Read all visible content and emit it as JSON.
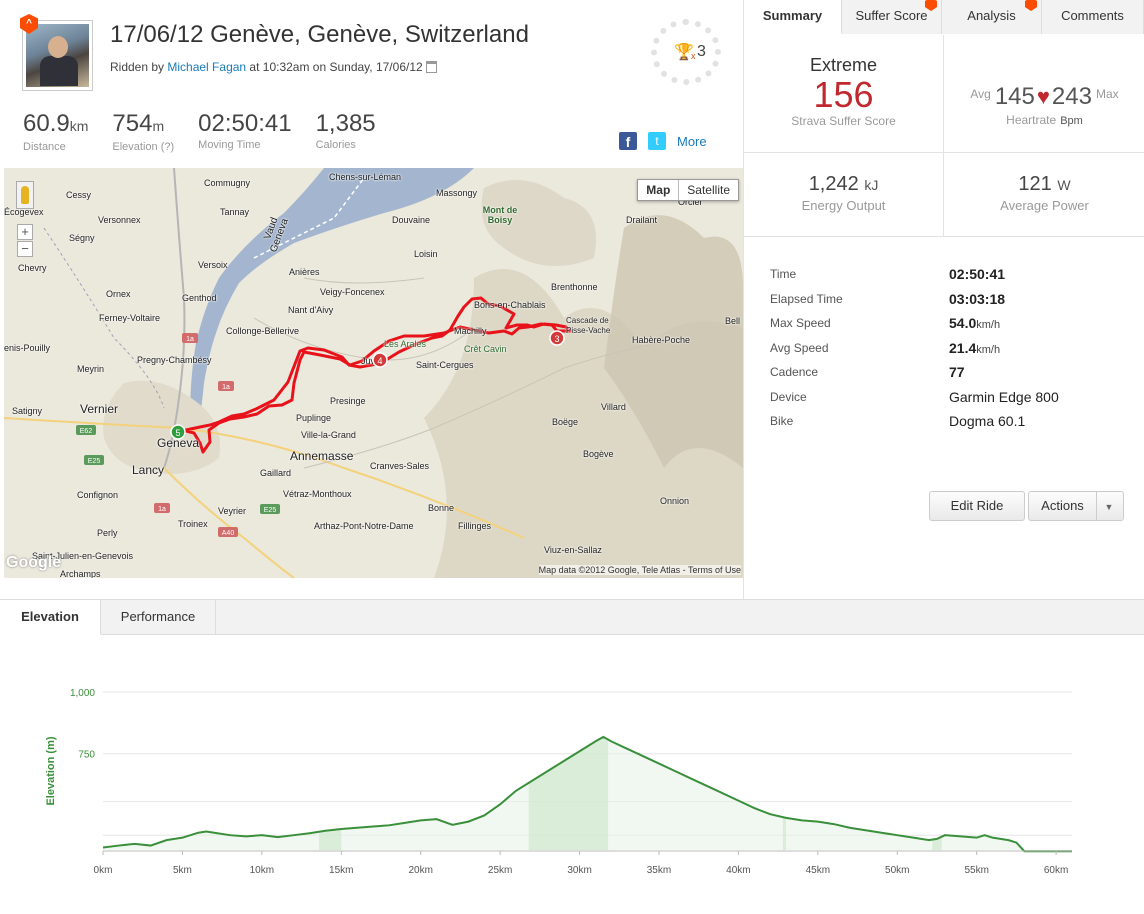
{
  "header": {
    "title": "17/06/12 Genève, Genève, Switzerland",
    "ridden_by_prefix": "Ridden by ",
    "athlete_name": "Michael Fagan",
    "ridden_suffix": " at 10:32am on Sunday, 17/06/12",
    "trophy_count": "3",
    "trophy_multiplier": "x"
  },
  "stats": [
    {
      "value": "60.9",
      "unit": "km",
      "label": "Distance"
    },
    {
      "value": "754",
      "unit": "m",
      "label": "Elevation (?)"
    },
    {
      "value": "02:50:41",
      "unit": "",
      "label": "Moving Time"
    },
    {
      "value": "1,385",
      "unit": "",
      "label": "Calories"
    }
  ],
  "share": {
    "facebook": "f",
    "twitter": "t",
    "more": "More"
  },
  "map": {
    "type_map": "Map",
    "type_satellite": "Satellite",
    "credit": "Map data ©2012 Google, Tele Atlas - Terms of Use",
    "google": "Google",
    "labels": [
      "Chens-sur-Léman",
      "Massongy",
      "Commugny",
      "Cessy",
      "Tannay",
      "Écogevex",
      "Versonnex",
      "Mont de Boisy",
      "Douvaine",
      "Drailant",
      "Orcier",
      "Ségny",
      "Vaud",
      "Geneva",
      "Chevry",
      "Versoix",
      "Anières",
      "Loisin",
      "Brenthonne",
      "Ornex",
      "Genthod",
      "Veigy-Foncenex",
      "Bons-en-Chablais",
      "Cascade de Pisse-Vache",
      "Ferney-Voltaire",
      "Nant d'Aivy",
      "Collonge-Bellerive",
      "Machilly",
      "Habère-Poche",
      "Bell",
      "enis-Pouilly",
      "Pregny-Chambésy",
      "Les Arales",
      "Crêt Cavin",
      "Saint-Cergues",
      "Meyrin",
      "Vernier",
      "Presinge",
      "Villard",
      "Satigny",
      "Puplinge",
      "Boëge",
      "Geneva",
      "Ville-la-Grand",
      "Lancy",
      "Annemasse",
      "Bogève",
      "Gaillard",
      "Cranves-Sales",
      "Confignon",
      "Vétraz-Monthoux",
      "Onnion",
      "Bonne",
      "Perly",
      "Veyrier",
      "Troinex",
      "Arthaz-Pont-Notre-Dame",
      "Fillinges",
      "Saint-Julien-en-Genevois",
      "Viuz-en-Sallaz",
      "Archamps",
      "Juv"
    ],
    "markers": [
      "5",
      "4",
      "3"
    ],
    "road_shields": [
      "E62",
      "E25",
      "1a",
      "1a",
      "E25",
      "A40",
      "1a"
    ]
  },
  "tabs": [
    {
      "label": "Summary",
      "active": true
    },
    {
      "label": "Suffer Score",
      "badge": true
    },
    {
      "label": "Analysis",
      "badge": true
    },
    {
      "label": "Comments"
    }
  ],
  "suffer": {
    "rating": "Extreme",
    "score": "156",
    "label": "Strava Suffer Score"
  },
  "heartrate": {
    "avg_label": "Avg",
    "avg": "145",
    "max": "243",
    "max_label": "Max",
    "label": "Heartrate",
    "unit": "Bpm"
  },
  "energy": {
    "value": "1,242",
    "unit": "kJ",
    "label": "Energy Output"
  },
  "power": {
    "value": "121",
    "unit": "W",
    "label": "Average Power"
  },
  "details": [
    {
      "key": "Time",
      "value": "02:50:41",
      "unit": "",
      "bold": true
    },
    {
      "key": "Elapsed Time",
      "value": "03:03:18",
      "unit": "",
      "bold": true
    },
    {
      "key": "Max Speed",
      "value": "54.0",
      "unit": "km/h",
      "bold": true
    },
    {
      "key": "Avg Speed",
      "value": "21.4",
      "unit": "km/h",
      "bold": true
    },
    {
      "key": "Cadence",
      "value": "77",
      "unit": "",
      "bold": true
    },
    {
      "key": "Device",
      "value": "Garmin Edge 800",
      "unit": "",
      "bold": false
    },
    {
      "key": "Bike",
      "value": "Dogma 60.1",
      "unit": "",
      "bold": false
    }
  ],
  "buttons": {
    "edit_ride": "Edit Ride",
    "actions": "Actions"
  },
  "bottom_tabs": [
    {
      "label": "Elevation",
      "active": true
    },
    {
      "label": "Performance"
    }
  ],
  "colors": {
    "accent": "#fc4c02",
    "suffer": "#c0282e",
    "link": "#1a7bb8",
    "elevation_line": "#3a8f3a"
  },
  "chart_data": {
    "type": "area",
    "title": "",
    "xlabel": "",
    "ylabel": "Elevation (m)",
    "x_tick_labels": [
      "0km",
      "5km",
      "10km",
      "15km",
      "20km",
      "25km",
      "30km",
      "35km",
      "40km",
      "45km",
      "50km",
      "55km",
      "60km"
    ],
    "y_tick_labels": [
      "1,000",
      "750"
    ],
    "xlim": [
      0,
      61
    ],
    "ylim": [
      360,
      1000
    ],
    "series": [
      {
        "x": [
          0,
          1,
          2,
          3,
          4,
          5,
          6,
          6.5,
          7,
          8,
          9,
          10,
          11,
          12,
          13,
          14,
          15,
          16,
          17,
          18,
          19,
          20,
          21,
          22,
          23,
          24,
          25,
          26,
          27,
          28,
          29,
          30,
          31,
          31.5,
          32,
          33,
          34,
          35,
          36,
          37,
          38,
          39,
          40,
          41,
          42,
          43,
          44,
          45,
          46,
          47,
          48,
          49,
          50,
          51,
          52,
          52.5,
          53,
          54,
          55,
          55.5,
          56,
          57,
          57.5,
          58,
          59,
          60,
          61
        ],
        "values": [
          370,
          378,
          385,
          378,
          400,
          410,
          430,
          435,
          430,
          420,
          415,
          420,
          412,
          420,
          428,
          438,
          445,
          450,
          455,
          460,
          470,
          480,
          485,
          462,
          475,
          500,
          545,
          600,
          640,
          680,
          720,
          760,
          800,
          818,
          800,
          770,
          740,
          710,
          680,
          650,
          620,
          590,
          560,
          530,
          505,
          490,
          480,
          475,
          465,
          450,
          440,
          430,
          420,
          410,
          400,
          405,
          420,
          415,
          410,
          420,
          410,
          400,
          390,
          355,
          355,
          355,
          355
        ]
      }
    ],
    "shaded_ranges": [
      [
        13.6,
        15
      ],
      [
        26.8,
        31.8
      ],
      [
        42.8,
        43
      ],
      [
        52.2,
        52.8
      ]
    ]
  }
}
